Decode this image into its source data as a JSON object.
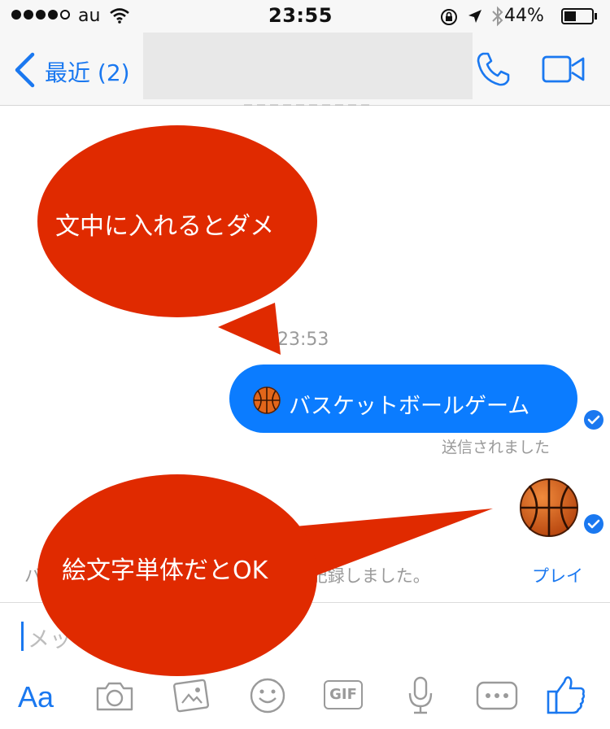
{
  "status_bar": {
    "carrier": "au",
    "time": "23:55",
    "battery_percent": "44%",
    "battery_level": 0.44
  },
  "nav": {
    "back_label": "最近 (2)"
  },
  "messages": {
    "timestamp": "23:53",
    "outgoing_text": "バスケットボールゲーム",
    "sent_status": "送信されました",
    "game_notice": "バスケットボールゲーム(ポイント)を記録しました。",
    "play_link": "プレイ"
  },
  "composer": {
    "placeholder": "メッセージ",
    "aa_label": "Aa",
    "gif_label": "GIF"
  },
  "annotations": {
    "callout_top": "文中に入れるとダメ",
    "callout_bottom": "絵文字単体だとOK",
    "callout_color": "#e02a00"
  },
  "colors": {
    "accent": "#1a78f0",
    "bubble": "#0b7cff"
  }
}
